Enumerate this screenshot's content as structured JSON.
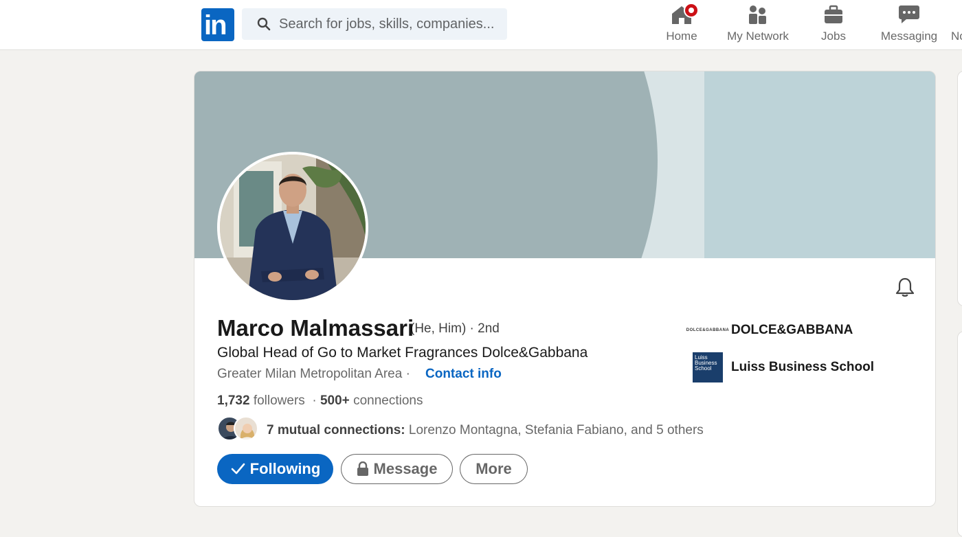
{
  "nav": {
    "logo_text": "in",
    "search_placeholder": "Search for jobs, skills, companies...",
    "items": [
      {
        "label": "Home",
        "icon": "home-icon"
      },
      {
        "label": "My Network",
        "icon": "network-icon"
      },
      {
        "label": "Jobs",
        "icon": "briefcase-icon"
      },
      {
        "label": "Messaging",
        "icon": "messaging-icon"
      },
      {
        "label": "No",
        "icon": "notifications-icon"
      }
    ]
  },
  "profile": {
    "name": "Marco Malmassari",
    "pronouns_degree": "(He, Him) · 2nd",
    "headline": "Global Head of Go to Market Fragrances Dolce&Gabbana",
    "location": "Greater Milan Metropolitan Area ·",
    "contact_label": "Contact info",
    "followers_count": "1,732",
    "followers_label": "followers",
    "stats_sep": "·",
    "connections_count": "500+",
    "connections_label": "connections",
    "mutual_label": "7 mutual connections:",
    "mutual_names": "Lorenzo Montagna, Stefania Fabiano, and 5 others"
  },
  "actions": {
    "following": "Following",
    "message": "Message",
    "more": "More"
  },
  "experience": [
    {
      "name": "DOLCE&GABBANA",
      "logo_text": "DOLCE&GABBANA"
    },
    {
      "name": "Luiss Business School",
      "logo_lines": [
        "Luiss",
        "Business",
        "School"
      ]
    }
  ],
  "colors": {
    "accent": "#0a66c2",
    "badge": "#cc1016",
    "banner_arc": "#9fb2b5",
    "banner_mid": "#d9e4e6",
    "banner_right": "#bdd3d8"
  }
}
